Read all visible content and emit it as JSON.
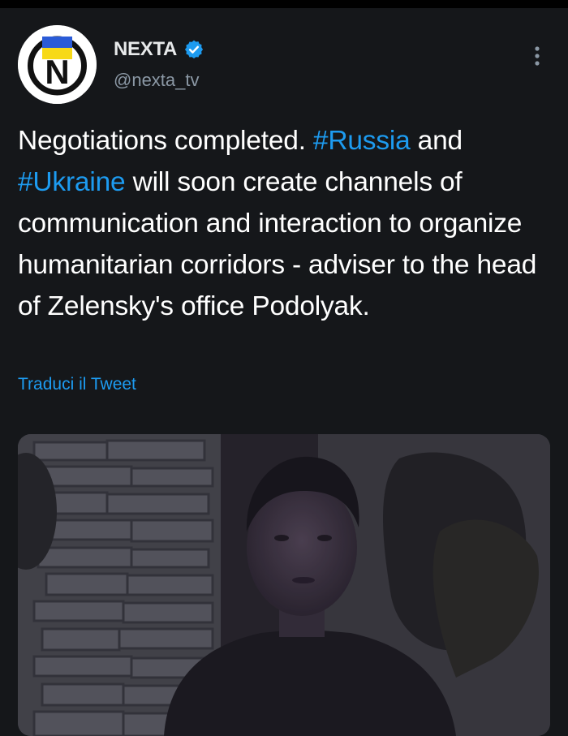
{
  "account": {
    "display_name": "NEXTA",
    "handle": "@nexta_tv",
    "verified": true,
    "avatar_letter": "N",
    "avatar_colors": {
      "blue": "#2a5bd7",
      "yellow": "#f7d917",
      "ring": "#111111"
    }
  },
  "tweet": {
    "text_1": "Negotiations completed. ",
    "hashtag_1": "#Russia",
    "text_2": " and ",
    "hashtag_2": "#Ukraine",
    "text_3": " will soon create channels of communication and interaction to organize humanitarian corridors - adviser to the head of Zelensky's office Podolyak.",
    "translate_label": "Traduci il Tweet"
  },
  "icons": {
    "more": "more-vertical-icon",
    "verified": "verified-badge-icon"
  },
  "colors": {
    "background": "#15171a",
    "text": "#ffffff",
    "secondary": "#8b98a5",
    "accent": "#1d9bf0"
  }
}
